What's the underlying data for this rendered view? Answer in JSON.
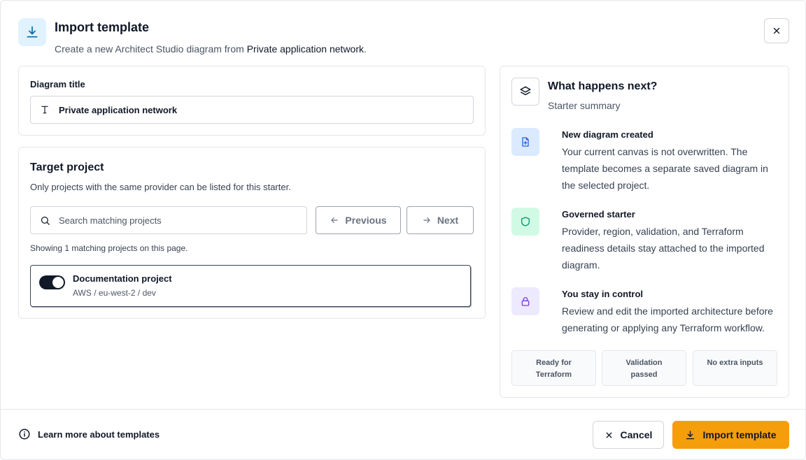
{
  "header": {
    "icon": "download-icon",
    "title": "Import template",
    "subtitle_prefix": "Create a new Architect Studio diagram from",
    "subtitle_template": "Private application network",
    "subtitle_suffix": ".",
    "close_icon": "close-icon"
  },
  "diagram_title": {
    "label": "Diagram title",
    "value": "Private application network",
    "icon": "text-type-icon"
  },
  "target_project": {
    "heading": "Target project",
    "description": "Only projects with the same provider can be listed for this starter.",
    "search_placeholder": "Search matching projects",
    "previous_label": "Previous",
    "next_label": "Next",
    "showing_text": "Showing 1 matching projects on this page.",
    "projects": [
      {
        "name": "Documentation project",
        "meta": "AWS / eu-west-2 / dev",
        "selected": true
      }
    ]
  },
  "next_panel": {
    "title": "What happens next?",
    "subtitle": "Starter summary",
    "steps": [
      {
        "icon": "file-plus-icon",
        "title": "New diagram created",
        "body": "Your current canvas is not overwritten. The template becomes a separate saved diagram in the selected project.",
        "color": "#2563eb",
        "bg": "#dbeafe"
      },
      {
        "icon": "shield-icon",
        "title": "Governed starter",
        "body": "Provider, region, validation, and Terraform readiness details stay attached to the imported diagram.",
        "color": "#059669",
        "bg": "#d1fae5"
      },
      {
        "icon": "lock-icon",
        "title": "You stay in control",
        "body": "Review and edit the imported architecture before generating or applying any Terraform workflow.",
        "color": "#7c3aed",
        "bg": "#ede9fe"
      }
    ],
    "badges": [
      "Ready for Terraform",
      "Validation passed",
      "No extra inputs"
    ]
  },
  "footer": {
    "learn_more": "Learn more about templates",
    "cancel_label": "Cancel",
    "import_label": "Import template"
  },
  "colors": {
    "accent": "#f59e0b",
    "header_icon_bg": "#e0f2fe",
    "header_icon_fg": "#0369a1"
  }
}
